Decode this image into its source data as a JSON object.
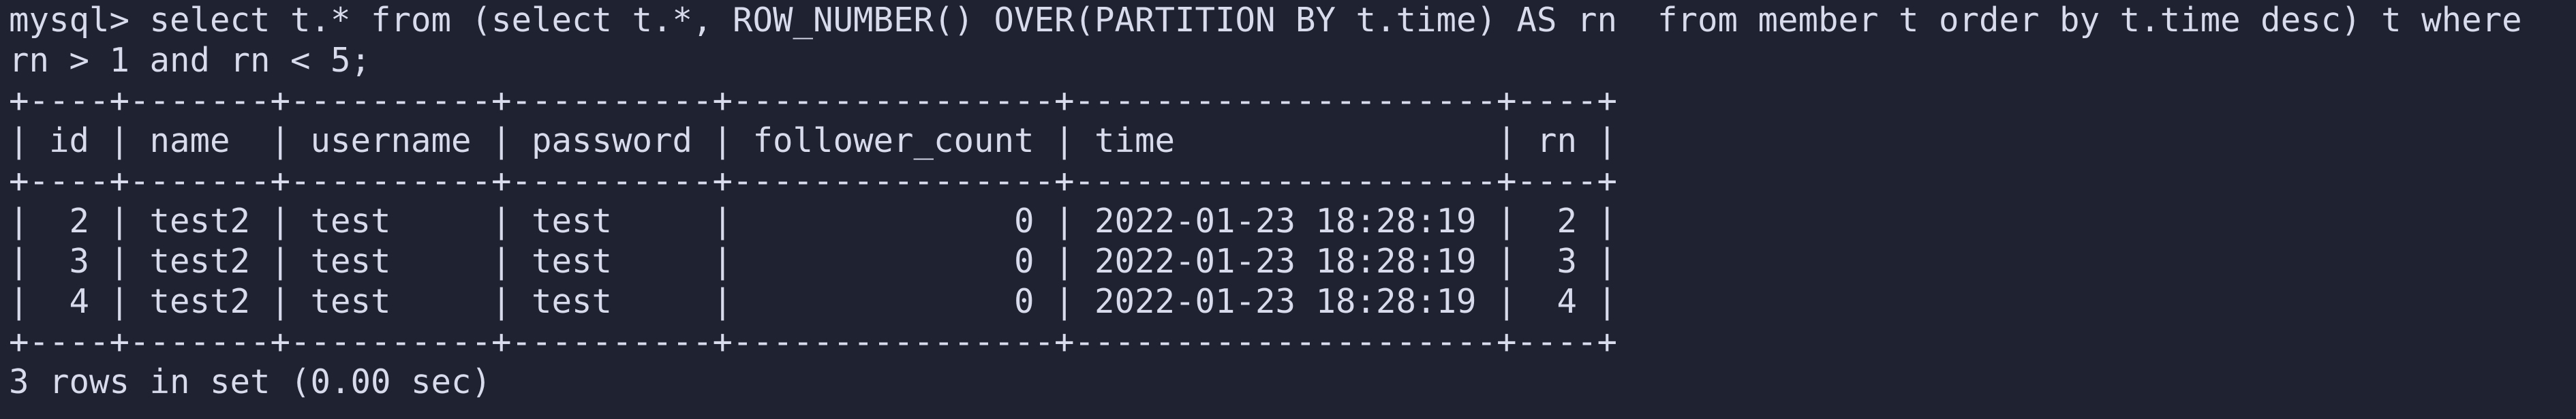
{
  "terminal": {
    "prompt": "mysql> ",
    "command_line_1": "select t.* from (select t.*, ROW_NUMBER() OVER(PARTITION BY t.time) AS rn  from member t order by t.time desc) t where",
    "command_line_2": "rn > 1 and rn < 5;",
    "table": {
      "border": "+----+-------+----------+----------+----------------+---------------------+----+",
      "header": "| id | name  | username | password | follower_count | time                | rn |",
      "rows": [
        "|  2 | test2 | test     | test     |              0 | 2022-01-23 18:28:19 |  2 |",
        "|  3 | test2 | test     | test     |              0 | 2022-01-23 18:28:19 |  3 |",
        "|  4 | test2 | test     | test     |              0 | 2022-01-23 18:28:19 |  4 |"
      ]
    },
    "result_summary": "3 rows in set (0.00 sec)"
  }
}
